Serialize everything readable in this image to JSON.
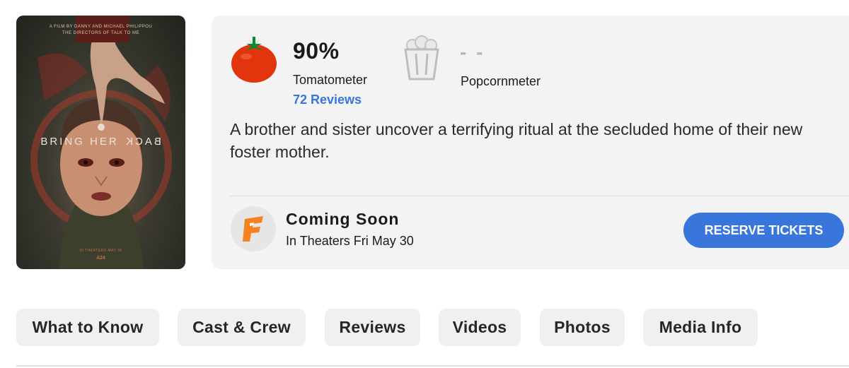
{
  "poster": {
    "tagline_top": "A FILM BY DANNY AND MICHAEL PHILIPPOU",
    "tagline_bottom": "THE DIRECTORS OF TALK TO ME",
    "title_main": "BRING HER ",
    "title_mirrored": "BACK",
    "release_line": "IN THEATERS MAY 30",
    "studio": "A24"
  },
  "scores": {
    "tomatometer_value": "90%",
    "tomatometer_label": "Tomatometer",
    "reviews_link": "72 Reviews",
    "popcornmeter_value": "- -",
    "popcornmeter_label": "Popcornmeter",
    "tomato_icon": "tomato-icon",
    "popcorn_icon": "popcorn-bucket-icon"
  },
  "synopsis": "A brother and sister uncover a terrifying ritual at the secluded home of their new foster mother.",
  "showtimes": {
    "icon": "fandango-icon",
    "title": "Coming Soon",
    "subtitle": "In Theaters Fri May 30",
    "button_label": "RESERVE TICKETS"
  },
  "tabs": [
    "What to Know",
    "Cast & Crew",
    "Reviews",
    "Videos",
    "Photos",
    "Media Info"
  ],
  "colors": {
    "accent_blue": "#3976dc",
    "tomato_red": "#e2350d",
    "fandango_orange": "#f5821f",
    "card_background": "#f3f3f3"
  }
}
